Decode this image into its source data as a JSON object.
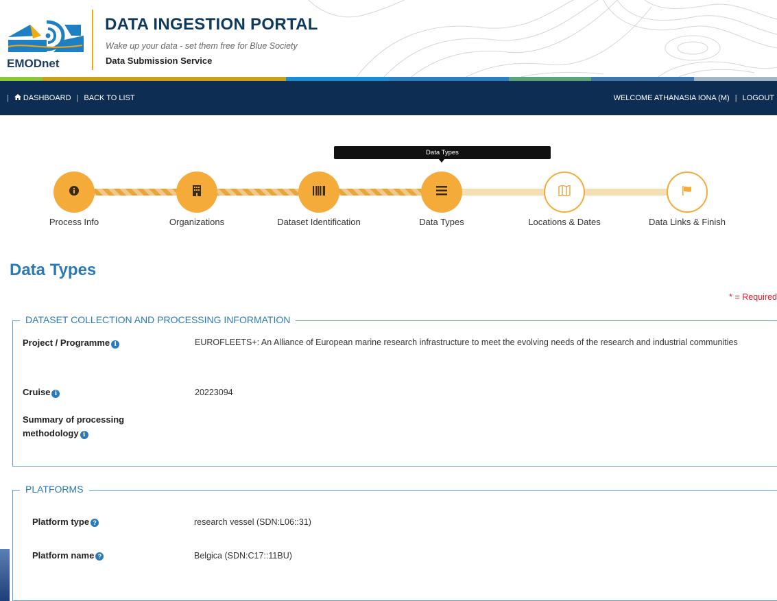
{
  "header": {
    "logo_text": "EMODnet",
    "title": "DATA INGESTION PORTAL",
    "tagline": "Wake up your data - set them free for Blue Society",
    "service": "Data Submission Service",
    "strip_colors": [
      "#8cc63f",
      "#c8a01e",
      "#1b8fd1",
      "#2d7fbf",
      "#5ba37a",
      "#3d78a8",
      "#a2b6c4"
    ]
  },
  "nav": {
    "dashboard": "DASHBOARD",
    "back_to_list": "BACK TO LIST",
    "separator": "|",
    "welcome": "WELCOME ATHANASIA IONA (M)",
    "logout": "LOGOUT"
  },
  "wizard": {
    "tooltip": "Data Types",
    "steps": [
      {
        "label": "Process Info",
        "icon": "info-icon",
        "state": "done"
      },
      {
        "label": "Organizations",
        "icon": "building-icon",
        "state": "done"
      },
      {
        "label": "Dataset Identification",
        "icon": "barcode-icon",
        "state": "done"
      },
      {
        "label": "Data Types",
        "icon": "list-icon",
        "state": "current"
      },
      {
        "label": "Locations & Dates",
        "icon": "map-icon",
        "state": "todo"
      },
      {
        "label": "Data Links & Finish",
        "icon": "flag-icon",
        "state": "todo"
      }
    ]
  },
  "page": {
    "title": "Data Types",
    "required_note": "* = Required"
  },
  "collection": {
    "legend": "DATASET COLLECTION AND PROCESSING INFORMATION",
    "project_label": "Project / Programme",
    "project_value": "EUROFLEETS+: An Alliance of European marine research infrastructure to meet the evolving needs of the research and industrial communities",
    "cruise_label": "Cruise",
    "cruise_value": "20223094",
    "summary_label": "Summary of processing methodology",
    "summary_value": ""
  },
  "platforms": {
    "legend": "PLATFORMS",
    "type_label": "Platform type",
    "type_value": "research vessel (SDN:L06::31)",
    "name_label": "Platform name",
    "name_value": "Belgica (SDN:C17::11BU)"
  },
  "colors": {
    "navy": "#0e2d52",
    "accent": "#f4ab3a",
    "link_blue": "#2a7ab8",
    "required_red": "#e8192c"
  }
}
